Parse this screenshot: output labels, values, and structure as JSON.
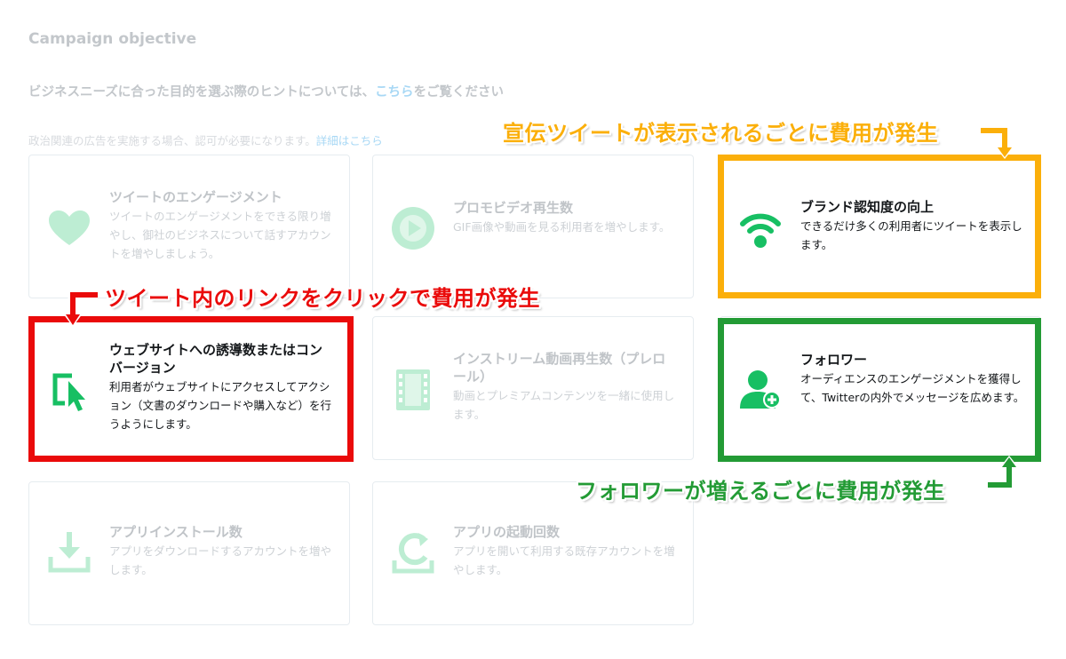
{
  "heading": "Campaign objective",
  "hint": {
    "prefix": "ビジネスニーズに合った目的を選ぶ際のヒントについては、",
    "link": "こちら",
    "suffix": "をご覧ください"
  },
  "political": {
    "text": "政治関連の広告を実施する場合、認可が必要になります。",
    "link": "詳細はこちら"
  },
  "cards": [
    {
      "id": "tweet-engagement",
      "icon": "heart-icon",
      "title": "ツイートのエンゲージメント",
      "desc": "ツイートのエンゲージメントをできる限り増やし、御社のビジネスについて話すアカウントを増やしましょう。"
    },
    {
      "id": "promoted-video",
      "icon": "play-circle-icon",
      "title": "プロモビデオ再生数",
      "desc": "GIF画像や動画を見る利用者を増やします。"
    },
    {
      "id": "brand-awareness",
      "icon": "broadcast-icon",
      "title": "ブランド認知度の向上",
      "desc": "できるだけ多くの利用者にツイートを表示します。"
    },
    {
      "id": "website-conversions",
      "icon": "cursor-click-icon",
      "title": "ウェブサイトへの誘導数またはコンバージョン",
      "desc": "利用者がウェブサイトにアクセスしてアクション（文書のダウンロードや購入など）を行うようにします。"
    },
    {
      "id": "in-stream-video",
      "icon": "film-icon",
      "title": "インストリーム動画再生数（プレロール）",
      "desc": "動画とプレミアムコンテンツを一緒に使用します。"
    },
    {
      "id": "followers",
      "icon": "add-follower-icon",
      "title": "フォロワー",
      "desc": "オーディエンスのエンゲージメントを獲得して、Twitterの内外でメッセージを広めます。"
    },
    {
      "id": "app-installs",
      "icon": "download-icon",
      "title": "アプリインストール数",
      "desc": "アプリをダウンロードするアカウントを増やします。"
    },
    {
      "id": "app-reengagements",
      "icon": "reopen-icon",
      "title": "アプリの起動回数",
      "desc": "アプリを開いて利用する既存アカウントを増やします。"
    }
  ],
  "callouts": {
    "orange": "宣伝ツイートが表示されるごとに費用が発生",
    "red": "ツイート内のリンクをクリックで費用が発生",
    "green": "フォロワーが増えるごとに費用が発生"
  },
  "colors": {
    "red": "#ea0a0a",
    "orange": "#fbaf0a",
    "green": "#239b35",
    "icon_green": "#17bf63"
  }
}
